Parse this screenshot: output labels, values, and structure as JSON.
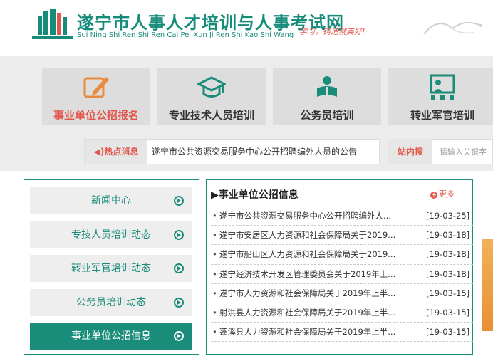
{
  "header": {
    "title": "遂宁市人事人才培训与人事考试网",
    "subtitle": "Sui Ning Shi Ren Shi Ren Cai Pei Xun Ji Ren Shi Kao Shi Wang",
    "slogan": "学习，铸造就美好!"
  },
  "nav": {
    "cards": [
      {
        "label": "事业单位公招报名",
        "icon": "edit-icon"
      },
      {
        "label": "专业技术人员培训",
        "icon": "graduation-cap-icon"
      },
      {
        "label": "公务员培训",
        "icon": "reader-icon"
      },
      {
        "label": "转业军官培训",
        "icon": "teacher-board-icon"
      }
    ]
  },
  "hot": {
    "label": "热点消息",
    "text": "遂宁市公共资源交易服务中心公开招聘编外人员的公告"
  },
  "search": {
    "label": "站内搜",
    "placeholder": "请输入关键字"
  },
  "side_menu": {
    "items": [
      {
        "label": "新闻中心"
      },
      {
        "label": "专技人员培训动态"
      },
      {
        "label": "转业军官培训动态"
      },
      {
        "label": "公务员培训动态"
      },
      {
        "label": "事业单位公招信息"
      }
    ]
  },
  "news": {
    "title": "▶事业单位公招信息",
    "more": "更多",
    "items": [
      {
        "title": "遂宁市公共资源交易服务中心公开招聘编外人...",
        "date": "[19-03-25]"
      },
      {
        "title": "遂宁市安居区人力资源和社会保障局关于2019...",
        "date": "[19-03-18]"
      },
      {
        "title": "遂宁市船山区人力资源和社会保障局关于2019...",
        "date": "[19-03-18]"
      },
      {
        "title": "遂宁经济技术开发区管理委员会关于2019年上...",
        "date": "[19-03-18]"
      },
      {
        "title": "遂宁市人力资源和社会保障局关于2019年上半...",
        "date": "[19-03-15]"
      },
      {
        "title": "射洪县人力资源和社会保障局关于2019年上半...",
        "date": "[19-03-15]"
      },
      {
        "title": "蓬溪县人力资源和社会保障局关于2019年上半...",
        "date": "[19-03-15]"
      }
    ]
  },
  "colors": {
    "brand": "#1a8c7a",
    "accent": "#e2574c"
  }
}
